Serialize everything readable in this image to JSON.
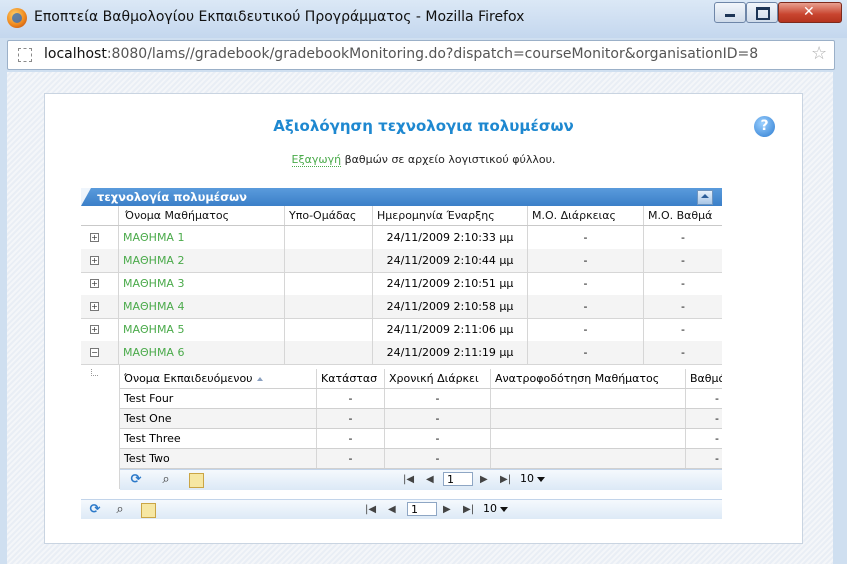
{
  "window": {
    "title": "Εποπτεία Βαθμολογίου Εκπαιδευτικού Προγράμματος - Mozilla Firefox",
    "close_glyph": "✕",
    "url_host": "localhost",
    "url_rest": ":8080/lams//gradebook/gradebookMonitoring.do?dispatch=courseMonitor&organisationID=8"
  },
  "page": {
    "title": "Αξιολόγηση τεχνολογια πολυμέσων",
    "help_glyph": "?",
    "export_link": "Εξαγωγή",
    "export_text": " βαθμών σε αρχείο λογιστικού φύλλου."
  },
  "grid": {
    "caption": "τεχνολογία πολυμέσων",
    "columns": [
      "Όνομα Μαθήματος",
      "Υπο-Ομάδας",
      "Ημερομηνία Έναρξης",
      "Μ.Ο. Διάρκειας",
      "Μ.Ο. Βαθμά"
    ],
    "rows": [
      {
        "expand": "+",
        "name": "ΜΑΘΗΜΑ 1",
        "subgroup": "",
        "start": "24/11/2009 2:10:33 μμ",
        "avg_time": "-",
        "avg_mark": "-"
      },
      {
        "expand": "+",
        "name": "ΜΑΘΗΜΑ 2",
        "subgroup": "",
        "start": "24/11/2009 2:10:44 μμ",
        "avg_time": "-",
        "avg_mark": "-"
      },
      {
        "expand": "+",
        "name": "ΜΑΘΗΜΑ 3",
        "subgroup": "",
        "start": "24/11/2009 2:10:51 μμ",
        "avg_time": "-",
        "avg_mark": "-"
      },
      {
        "expand": "+",
        "name": "ΜΑΘΗΜΑ 4",
        "subgroup": "",
        "start": "24/11/2009 2:10:58 μμ",
        "avg_time": "-",
        "avg_mark": "-"
      },
      {
        "expand": "+",
        "name": "ΜΑΘΗΜΑ 5",
        "subgroup": "",
        "start": "24/11/2009 2:11:06 μμ",
        "avg_time": "-",
        "avg_mark": "-"
      },
      {
        "expand": "−",
        "name": "ΜΑΘΗΜΑ 6",
        "subgroup": "",
        "start": "24/11/2009 2:11:19 μμ",
        "avg_time": "-",
        "avg_mark": "-"
      }
    ],
    "subgrid": {
      "columns": [
        "Όνομα Εκπαιδευόμενου",
        "Κατάστασ",
        "Χρονική Διάρκει",
        "Ανατροφοδότηση Μαθήματος",
        "Βαθμό"
      ],
      "rows": [
        {
          "name": "Test Four",
          "status": "-",
          "time": "-",
          "feedback": "",
          "mark": "-"
        },
        {
          "name": "Test One",
          "status": "-",
          "time": "-",
          "feedback": "",
          "mark": "-"
        },
        {
          "name": "Test Three",
          "status": "-",
          "time": "-",
          "feedback": "",
          "mark": "-"
        },
        {
          "name": "Test Two",
          "status": "-",
          "time": "-",
          "feedback": "",
          "mark": "-"
        }
      ],
      "pager": {
        "page": "1",
        "page_size": "10"
      }
    },
    "pager": {
      "page": "1",
      "page_size": "10"
    },
    "icons": {
      "refresh": "⟳",
      "search": "⌕",
      "first": "|◀",
      "prev": "◀",
      "next": "▶",
      "last": "▶|"
    }
  }
}
